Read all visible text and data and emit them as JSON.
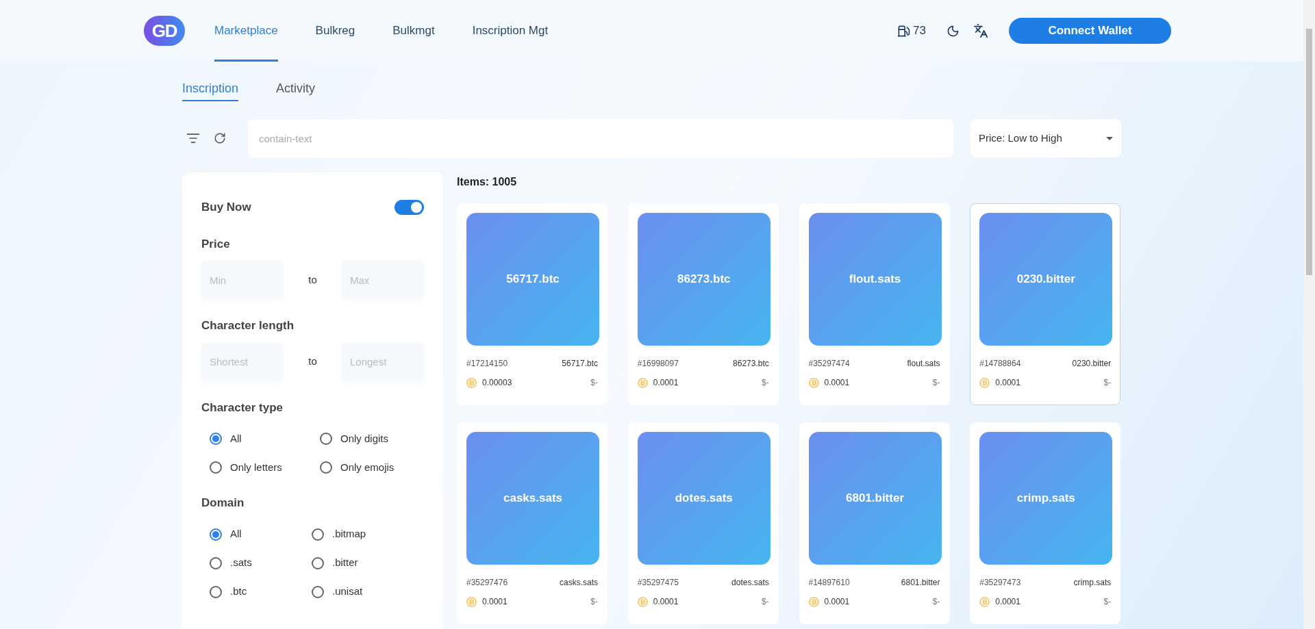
{
  "header": {
    "logo": "GD",
    "nav": [
      {
        "label": "Marketplace",
        "selected": true
      },
      {
        "label": "Bulkreg",
        "selected": false
      },
      {
        "label": "Bulkmgt",
        "selected": false
      },
      {
        "label": "Inscription Mgt",
        "selected": false
      }
    ],
    "gas": "73",
    "connect_button": "Connect Wallet"
  },
  "tabs": [
    {
      "label": "Inscription",
      "selected": true
    },
    {
      "label": "Activity",
      "selected": false
    }
  ],
  "search": {
    "placeholder": "contain-text"
  },
  "sort": {
    "value": "Price: Low to High"
  },
  "filters": {
    "buy_now": {
      "label": "Buy Now",
      "on": true
    },
    "price": {
      "title": "Price",
      "min_placeholder": "Min",
      "separator": "to",
      "max_placeholder": "Max"
    },
    "length": {
      "title": "Character length",
      "min_placeholder": "Shortest",
      "separator": "to",
      "max_placeholder": "Longest"
    },
    "character_type": {
      "title": "Character type",
      "options": [
        {
          "label": "All",
          "selected": true
        },
        {
          "label": "Only digits",
          "selected": false
        },
        {
          "label": "Only letters",
          "selected": false
        },
        {
          "label": "Only emojis",
          "selected": false
        }
      ]
    },
    "domain": {
      "title": "Domain",
      "options": [
        {
          "label": "All",
          "selected": true
        },
        {
          "label": ".bitmap",
          "selected": false
        },
        {
          "label": ".sats",
          "selected": false
        },
        {
          "label": ".bitter",
          "selected": false
        },
        {
          "label": ".btc",
          "selected": false
        },
        {
          "label": ".unisat",
          "selected": false
        }
      ]
    }
  },
  "items_count": "Items: 1005",
  "items": [
    {
      "title": "56717.btc",
      "number": "#17214150",
      "name": "56717.btc",
      "price": "0.00003",
      "usd": "$-",
      "selected": false
    },
    {
      "title": "86273.btc",
      "number": "#16998097",
      "name": "86273.btc",
      "price": "0.0001",
      "usd": "$-",
      "selected": false
    },
    {
      "title": "flout.sats",
      "number": "#35297474",
      "name": "flout.sats",
      "price": "0.0001",
      "usd": "$-",
      "selected": false
    },
    {
      "title": "0230.bitter",
      "number": "#14788864",
      "name": "0230.bitter",
      "price": "0.0001",
      "usd": "$-",
      "selected": true
    },
    {
      "title": "casks.sats",
      "number": "#35297476",
      "name": "casks.sats",
      "price": "0.0001",
      "usd": "$-",
      "selected": false
    },
    {
      "title": "dotes.sats",
      "number": "#35297475",
      "name": "dotes.sats",
      "price": "0.0001",
      "usd": "$-",
      "selected": false
    },
    {
      "title": "6801.bitter",
      "number": "#14897610",
      "name": "6801.bitter",
      "price": "0.0001",
      "usd": "$-",
      "selected": false
    },
    {
      "title": "crimp.sats",
      "number": "#35297473",
      "name": "crimp.sats",
      "price": "0.0001",
      "usd": "$-",
      "selected": false
    }
  ]
}
